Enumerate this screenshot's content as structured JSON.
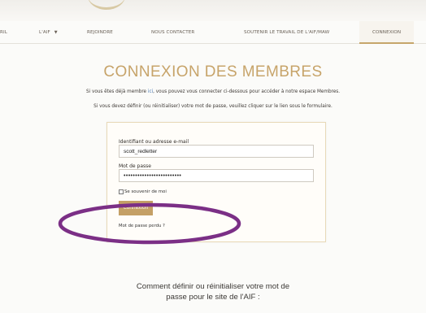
{
  "nav": {
    "items": [
      {
        "label": "RIL"
      },
      {
        "label": "L'AIF",
        "has_dropdown": true,
        "caret": "▼"
      },
      {
        "label": "REJOINDRE"
      },
      {
        "label": "NOUS CONTACTER"
      },
      {
        "label": "SOUTENIR LE TRAVAIL DE L'AIF/MAW"
      },
      {
        "label": "CONNEXION",
        "active": true
      }
    ]
  },
  "page": {
    "title": "CONNEXION DES MEMBRES",
    "intro_line1_before": "Si vous êtes déjà membre ",
    "intro_line1_link": "ici",
    "intro_line1_after": ", vous pouvez vous connecter ci-dessous pour accéder à notre espace Membres.",
    "intro_line2": "Si vous devez définir (ou réinitialiser) votre mot de passe, veuillez cliquer sur le lien sous le formulaire."
  },
  "login_form": {
    "username_label": "Identifiant ou adresse e-mail",
    "username_value": "scott_redletter",
    "password_label": "Mot de passe",
    "password_value": "•••••••••••••••••••••••••",
    "remember_label": "Se souvenir de moi",
    "submit_label": "Connexion",
    "lost_password_label": "Mot de passe perdu ?"
  },
  "annotation": {
    "color": "#7b2f86"
  },
  "bottom": {
    "heading_line1": "Comment définir ou réinitialiser votre mot de",
    "heading_line2": "passe pour le site de l'AIF :"
  },
  "colors": {
    "accent_gold": "#c4a066",
    "title_gold": "#c7a46a",
    "link_blue": "#4a78b3"
  }
}
